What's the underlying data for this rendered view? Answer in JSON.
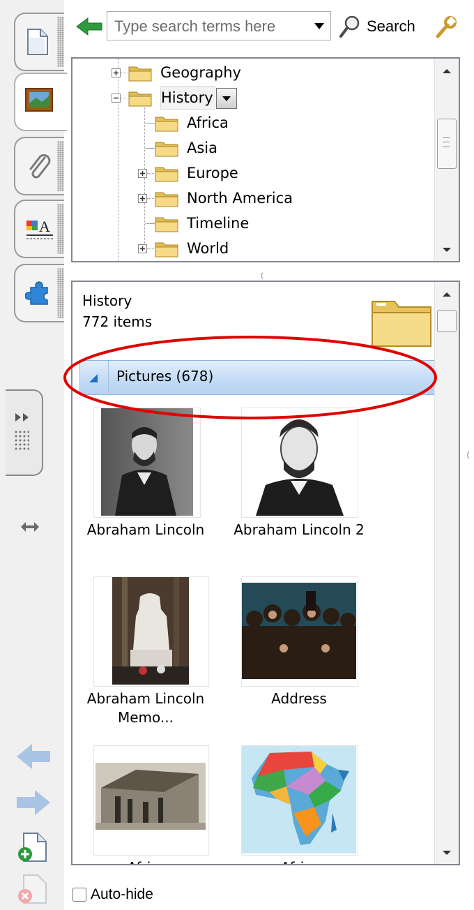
{
  "search": {
    "placeholder": "Type search terms here",
    "button_label": "Search"
  },
  "tree": {
    "items": [
      {
        "label": "Geography",
        "expander": "plus"
      },
      {
        "label": "History",
        "expander": "minus",
        "selected": true
      },
      {
        "label": "Africa",
        "expander": "none"
      },
      {
        "label": "Asia",
        "expander": "none"
      },
      {
        "label": "Europe",
        "expander": "plus"
      },
      {
        "label": "North America",
        "expander": "plus"
      },
      {
        "label": "Timeline",
        "expander": "none"
      },
      {
        "label": "World",
        "expander": "plus"
      }
    ]
  },
  "results": {
    "folder_name": "History",
    "item_count": "772 items",
    "group_header": "Pictures (678)",
    "items": [
      {
        "label": "Abraham Lincoln"
      },
      {
        "label": "Abraham Lincoln 2"
      },
      {
        "label": "Abraham Lincoln Memo..."
      },
      {
        "label": "Address"
      },
      {
        "label": "Afri..."
      },
      {
        "label": "Afri..."
      }
    ]
  },
  "footer": {
    "autohide_label": "Auto-hide",
    "autohide_checked": false
  },
  "colors": {
    "group_header_bg": "#cfe3f8",
    "highlight_ellipse": "#e00000",
    "nav_arrow": "#a9c4e4",
    "back_arrow": "#2f9a3d",
    "folder": "#f4d77e"
  }
}
